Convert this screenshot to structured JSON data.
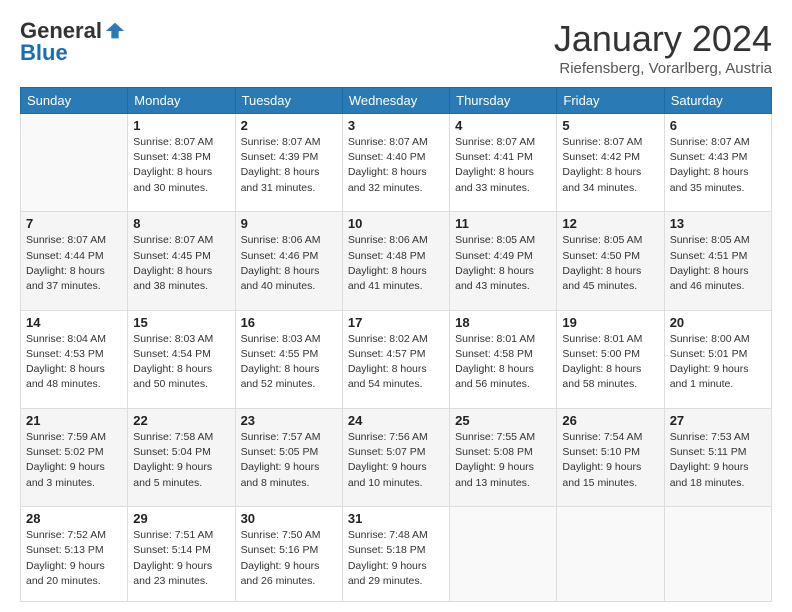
{
  "logo": {
    "general": "General",
    "blue": "Blue"
  },
  "header": {
    "month": "January 2024",
    "location": "Riefensberg, Vorarlberg, Austria"
  },
  "weekdays": [
    "Sunday",
    "Monday",
    "Tuesday",
    "Wednesday",
    "Thursday",
    "Friday",
    "Saturday"
  ],
  "weeks": [
    [
      {
        "day": "",
        "sunrise": "",
        "sunset": "",
        "daylight": ""
      },
      {
        "day": "1",
        "sunrise": "Sunrise: 8:07 AM",
        "sunset": "Sunset: 4:38 PM",
        "daylight": "Daylight: 8 hours and 30 minutes."
      },
      {
        "day": "2",
        "sunrise": "Sunrise: 8:07 AM",
        "sunset": "Sunset: 4:39 PM",
        "daylight": "Daylight: 8 hours and 31 minutes."
      },
      {
        "day": "3",
        "sunrise": "Sunrise: 8:07 AM",
        "sunset": "Sunset: 4:40 PM",
        "daylight": "Daylight: 8 hours and 32 minutes."
      },
      {
        "day": "4",
        "sunrise": "Sunrise: 8:07 AM",
        "sunset": "Sunset: 4:41 PM",
        "daylight": "Daylight: 8 hours and 33 minutes."
      },
      {
        "day": "5",
        "sunrise": "Sunrise: 8:07 AM",
        "sunset": "Sunset: 4:42 PM",
        "daylight": "Daylight: 8 hours and 34 minutes."
      },
      {
        "day": "6",
        "sunrise": "Sunrise: 8:07 AM",
        "sunset": "Sunset: 4:43 PM",
        "daylight": "Daylight: 8 hours and 35 minutes."
      }
    ],
    [
      {
        "day": "7",
        "sunrise": "Sunrise: 8:07 AM",
        "sunset": "Sunset: 4:44 PM",
        "daylight": "Daylight: 8 hours and 37 minutes."
      },
      {
        "day": "8",
        "sunrise": "Sunrise: 8:07 AM",
        "sunset": "Sunset: 4:45 PM",
        "daylight": "Daylight: 8 hours and 38 minutes."
      },
      {
        "day": "9",
        "sunrise": "Sunrise: 8:06 AM",
        "sunset": "Sunset: 4:46 PM",
        "daylight": "Daylight: 8 hours and 40 minutes."
      },
      {
        "day": "10",
        "sunrise": "Sunrise: 8:06 AM",
        "sunset": "Sunset: 4:48 PM",
        "daylight": "Daylight: 8 hours and 41 minutes."
      },
      {
        "day": "11",
        "sunrise": "Sunrise: 8:05 AM",
        "sunset": "Sunset: 4:49 PM",
        "daylight": "Daylight: 8 hours and 43 minutes."
      },
      {
        "day": "12",
        "sunrise": "Sunrise: 8:05 AM",
        "sunset": "Sunset: 4:50 PM",
        "daylight": "Daylight: 8 hours and 45 minutes."
      },
      {
        "day": "13",
        "sunrise": "Sunrise: 8:05 AM",
        "sunset": "Sunset: 4:51 PM",
        "daylight": "Daylight: 8 hours and 46 minutes."
      }
    ],
    [
      {
        "day": "14",
        "sunrise": "Sunrise: 8:04 AM",
        "sunset": "Sunset: 4:53 PM",
        "daylight": "Daylight: 8 hours and 48 minutes."
      },
      {
        "day": "15",
        "sunrise": "Sunrise: 8:03 AM",
        "sunset": "Sunset: 4:54 PM",
        "daylight": "Daylight: 8 hours and 50 minutes."
      },
      {
        "day": "16",
        "sunrise": "Sunrise: 8:03 AM",
        "sunset": "Sunset: 4:55 PM",
        "daylight": "Daylight: 8 hours and 52 minutes."
      },
      {
        "day": "17",
        "sunrise": "Sunrise: 8:02 AM",
        "sunset": "Sunset: 4:57 PM",
        "daylight": "Daylight: 8 hours and 54 minutes."
      },
      {
        "day": "18",
        "sunrise": "Sunrise: 8:01 AM",
        "sunset": "Sunset: 4:58 PM",
        "daylight": "Daylight: 8 hours and 56 minutes."
      },
      {
        "day": "19",
        "sunrise": "Sunrise: 8:01 AM",
        "sunset": "Sunset: 5:00 PM",
        "daylight": "Daylight: 8 hours and 58 minutes."
      },
      {
        "day": "20",
        "sunrise": "Sunrise: 8:00 AM",
        "sunset": "Sunset: 5:01 PM",
        "daylight": "Daylight: 9 hours and 1 minute."
      }
    ],
    [
      {
        "day": "21",
        "sunrise": "Sunrise: 7:59 AM",
        "sunset": "Sunset: 5:02 PM",
        "daylight": "Daylight: 9 hours and 3 minutes."
      },
      {
        "day": "22",
        "sunrise": "Sunrise: 7:58 AM",
        "sunset": "Sunset: 5:04 PM",
        "daylight": "Daylight: 9 hours and 5 minutes."
      },
      {
        "day": "23",
        "sunrise": "Sunrise: 7:57 AM",
        "sunset": "Sunset: 5:05 PM",
        "daylight": "Daylight: 9 hours and 8 minutes."
      },
      {
        "day": "24",
        "sunrise": "Sunrise: 7:56 AM",
        "sunset": "Sunset: 5:07 PM",
        "daylight": "Daylight: 9 hours and 10 minutes."
      },
      {
        "day": "25",
        "sunrise": "Sunrise: 7:55 AM",
        "sunset": "Sunset: 5:08 PM",
        "daylight": "Daylight: 9 hours and 13 minutes."
      },
      {
        "day": "26",
        "sunrise": "Sunrise: 7:54 AM",
        "sunset": "Sunset: 5:10 PM",
        "daylight": "Daylight: 9 hours and 15 minutes."
      },
      {
        "day": "27",
        "sunrise": "Sunrise: 7:53 AM",
        "sunset": "Sunset: 5:11 PM",
        "daylight": "Daylight: 9 hours and 18 minutes."
      }
    ],
    [
      {
        "day": "28",
        "sunrise": "Sunrise: 7:52 AM",
        "sunset": "Sunset: 5:13 PM",
        "daylight": "Daylight: 9 hours and 20 minutes."
      },
      {
        "day": "29",
        "sunrise": "Sunrise: 7:51 AM",
        "sunset": "Sunset: 5:14 PM",
        "daylight": "Daylight: 9 hours and 23 minutes."
      },
      {
        "day": "30",
        "sunrise": "Sunrise: 7:50 AM",
        "sunset": "Sunset: 5:16 PM",
        "daylight": "Daylight: 9 hours and 26 minutes."
      },
      {
        "day": "31",
        "sunrise": "Sunrise: 7:48 AM",
        "sunset": "Sunset: 5:18 PM",
        "daylight": "Daylight: 9 hours and 29 minutes."
      },
      {
        "day": "",
        "sunrise": "",
        "sunset": "",
        "daylight": ""
      },
      {
        "day": "",
        "sunrise": "",
        "sunset": "",
        "daylight": ""
      },
      {
        "day": "",
        "sunrise": "",
        "sunset": "",
        "daylight": ""
      }
    ]
  ]
}
